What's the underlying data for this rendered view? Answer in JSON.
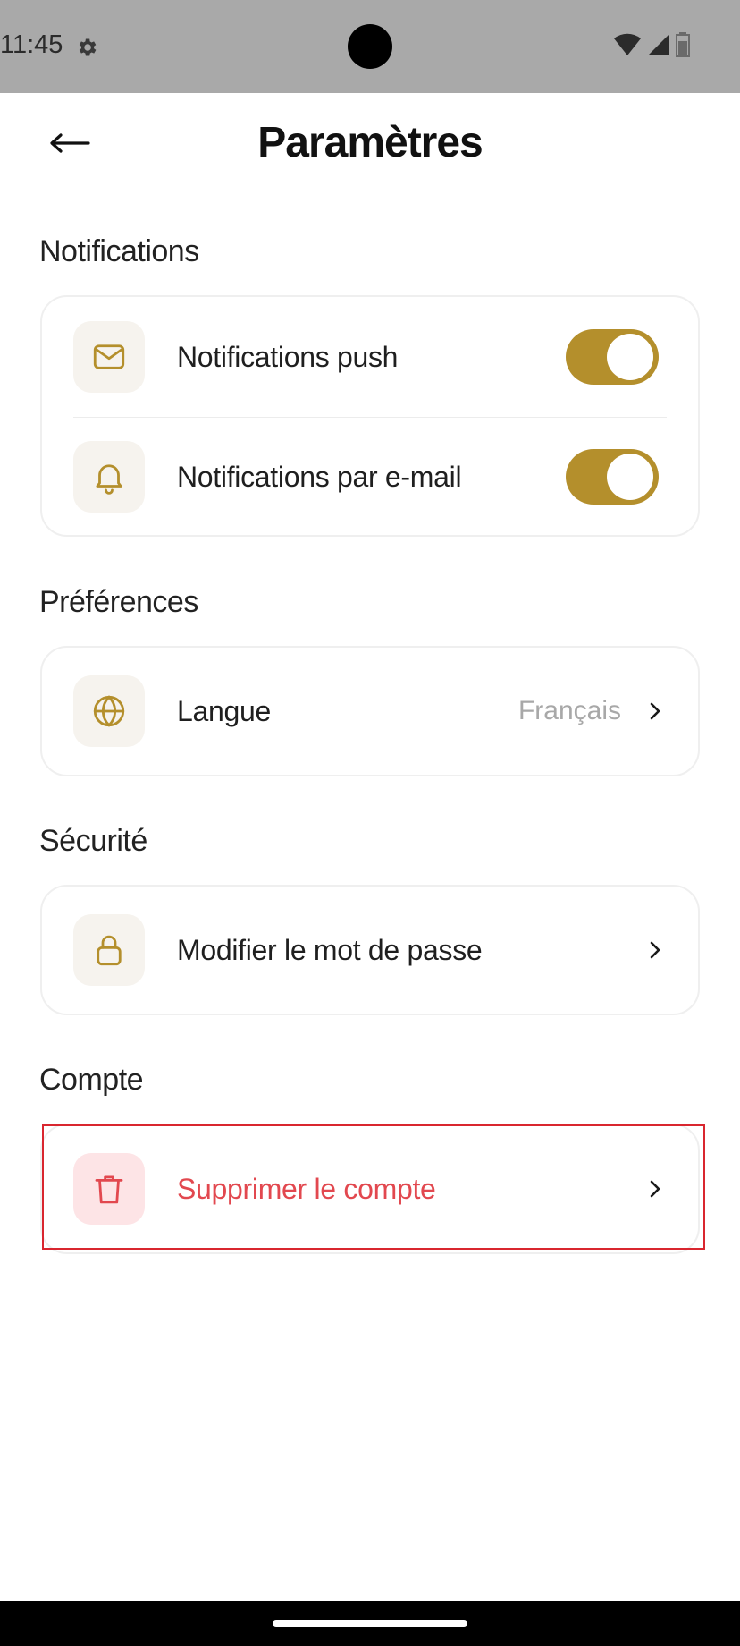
{
  "status": {
    "time": "11:45"
  },
  "header": {
    "title": "Paramètres"
  },
  "sections": {
    "notifications": {
      "title": "Notifications",
      "push_label": "Notifications push",
      "push_enabled": true,
      "email_label": "Notifications par e-mail",
      "email_enabled": true
    },
    "preferences": {
      "title": "Préférences",
      "language_label": "Langue",
      "language_value": "Français"
    },
    "security": {
      "title": "Sécurité",
      "password_label": "Modifier le mot de passe"
    },
    "account": {
      "title": "Compte",
      "delete_label": "Supprimer le compte"
    }
  },
  "colors": {
    "accent": "#b48f2c",
    "danger": "#e2484f",
    "icon_bg": "#f6f3ee",
    "danger_bg": "#fde4e6",
    "highlight_border": "#d9262f"
  },
  "icons": {
    "back": "arrow-left-icon",
    "push": "mail-icon",
    "email": "bell-icon",
    "language": "globe-icon",
    "password": "lock-icon",
    "delete": "trash-icon",
    "chevron": "chevron-right-icon"
  }
}
